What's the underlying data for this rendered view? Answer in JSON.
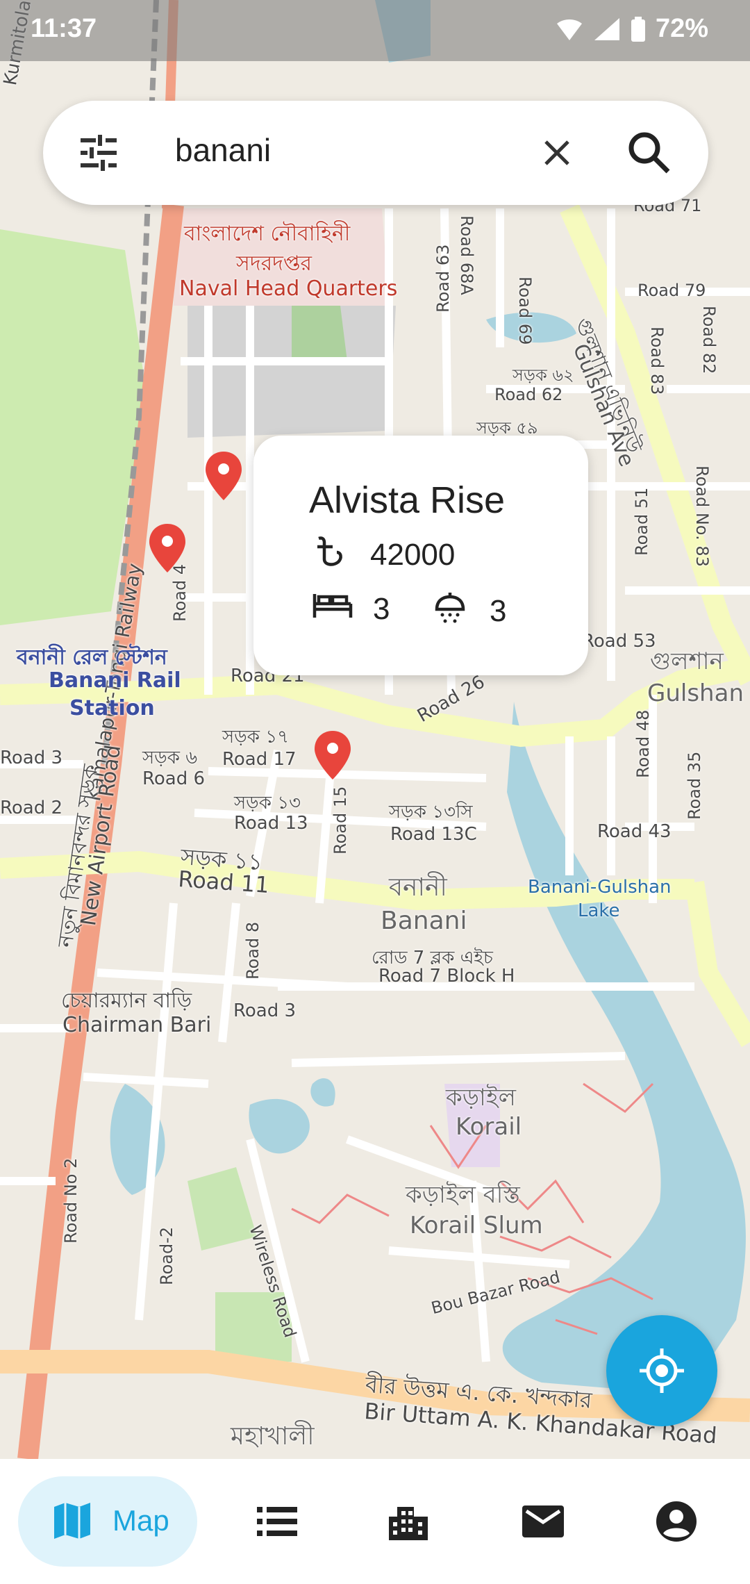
{
  "status_bar": {
    "time": "11:37",
    "battery": "72%",
    "icons": [
      "wifi-icon",
      "signal-icon",
      "battery-icon"
    ]
  },
  "search": {
    "query": "banani",
    "icons": [
      "filter-icon",
      "clear-icon",
      "search-icon"
    ]
  },
  "map_labels": {
    "naval_bn_1": "বাংলাদেশ নৌবাহিনী",
    "naval_bn_2": "সদরদপ্তর",
    "naval_en": "Naval Head Quarters",
    "road_71": "Road 71",
    "road_79": "Road 79",
    "road_69": "Road 69",
    "road_68a": "Road 68A",
    "road_63": "Road 63",
    "road_62_bn": "সড়ক ৬২",
    "road_62": "Road 62",
    "road_59_bn": "সড়ক ৫৯",
    "gulshan_ave_bn": "গুলশান এভিনিউ",
    "gulshan_ave": "Gulshan Ave",
    "road_83": "Road 83",
    "road_no_83": "Road No. 83",
    "road_82": "Road 82",
    "road_51": "Road 51",
    "road_53": "Road 53",
    "gulshan_bn": "গুলশান",
    "gulshan": "Gulshan",
    "road_48": "Road 48",
    "road_35": "Road 35",
    "road_43": "Road 43",
    "kamalapur_railway": "Kamalapur-Tongi Railway",
    "banani_rail_bn": "বনানী রেল স্টেশন",
    "banani_rail_1": "Banani Rail",
    "banani_rail_2": "Station",
    "road_4": "Road 4",
    "road_21": "Road 21",
    "road_26": "Road 26",
    "road_17_bn": "সড়ক ১৭",
    "road_17": "Road 17",
    "road_6_bn": "সড়ক ৬",
    "road_6": "Road 6",
    "road_13_bn": "সড়ক ১৩",
    "road_13": "Road 13",
    "road_15": "Road 15",
    "road_13c_bn": "সড়ক ১৩সি",
    "road_13c": "Road 13C",
    "road_11_bn": "সড়ক ১১",
    "road_11": "Road 11",
    "banani_bn": "বনানী",
    "banani": "Banani",
    "banani_lake_1": "Banani-Gulshan",
    "banani_lake_2": "Lake",
    "road_7_bn": "রোড 7 ব্লক এইচ",
    "road_7": "Road 7 Block H",
    "road_8": "Road 8",
    "road_3": "Road 3",
    "airport_bn": "নতুন বিমানবন্দর সড়ক",
    "airport": "New Airport Road",
    "chairman_bn": "চেয়ারম্যান বাড়ি",
    "chairman": "Chairman Bari",
    "korail_bn": "কড়াইল",
    "korail": "Korail",
    "korail_slum_bn": "কড়াইল বস্তি",
    "korail_slum": "Korail Slum",
    "bou_bazar": "Bou Bazar Road",
    "road_no_2": "Road No 2",
    "road_2": "Road-2",
    "wireless": "Wireless Road",
    "bir_uttam_bn": "বীর উত্তম এ. কে. খন্দকার",
    "bir_uttam": "Bir Uttam A. K. Khandakar Road",
    "mohakhali_bn": "মহাখালী",
    "road_3_left": "Road 3",
    "road_2_left": "Road 2",
    "kurmitola": "Kurmitola"
  },
  "popup": {
    "title": "Alvista Rise",
    "price": "42000",
    "beds": "3",
    "baths": "3",
    "icons": [
      "taka-icon",
      "bed-icon",
      "shower-icon"
    ]
  },
  "bottom_nav": {
    "map_label": "Map",
    "icons": [
      "map-icon",
      "list-icon",
      "building-icon",
      "mail-icon",
      "account-icon"
    ]
  },
  "colors": {
    "accent": "#1aa5dd",
    "marker": "#e8453c",
    "primary_road": "#f6fabe",
    "motorway": "#f2a085",
    "water": "#aad3df"
  }
}
